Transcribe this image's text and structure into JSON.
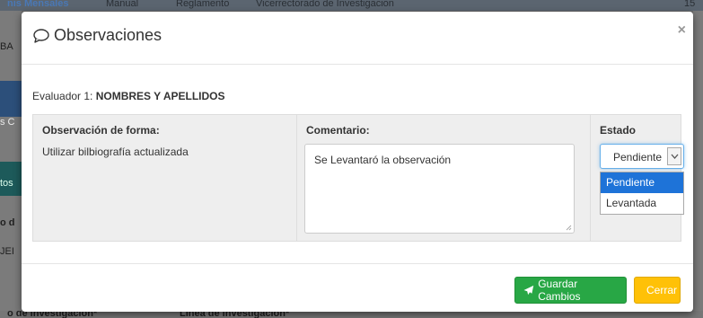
{
  "background": {
    "top_items": [
      "nis Mensales",
      "Manual",
      "Reglamento",
      "Vicerrectorado de Investigacion",
      "15"
    ],
    "left_fragments": [
      "BA",
      "s C",
      "tos",
      "o d",
      "JEI"
    ],
    "bottom_items": [
      "o de investigacion*",
      "Linea de investigacion*"
    ]
  },
  "modal": {
    "title": "Observaciones",
    "close_label": "×",
    "evaluador_prefix": "Evaluador 1: ",
    "evaluador_name": "NOMBRES Y APELLIDOS",
    "columns": {
      "forma_header": "Observación de forma:",
      "forma_text": "Utilizar bilbiografía actualizada",
      "comentario_header": "Comentario:",
      "comentario_value": "Se Levantaró la observación",
      "estado_header": "Estado"
    },
    "estado_select": {
      "selected": "Pendiente",
      "options": [
        "Pendiente",
        "Levantada"
      ]
    },
    "buttons": {
      "save": "Guardar Cambios",
      "close": "Cerrar"
    }
  },
  "colors": {
    "save": "#28a745",
    "close": "#ffc107",
    "option_highlight": "#1e73d8"
  },
  "icons": [
    "speech-bubble-icon",
    "close-icon",
    "chevron-down-icon",
    "paper-plane-icon",
    "times-icon",
    "resize-grip-icon"
  ]
}
